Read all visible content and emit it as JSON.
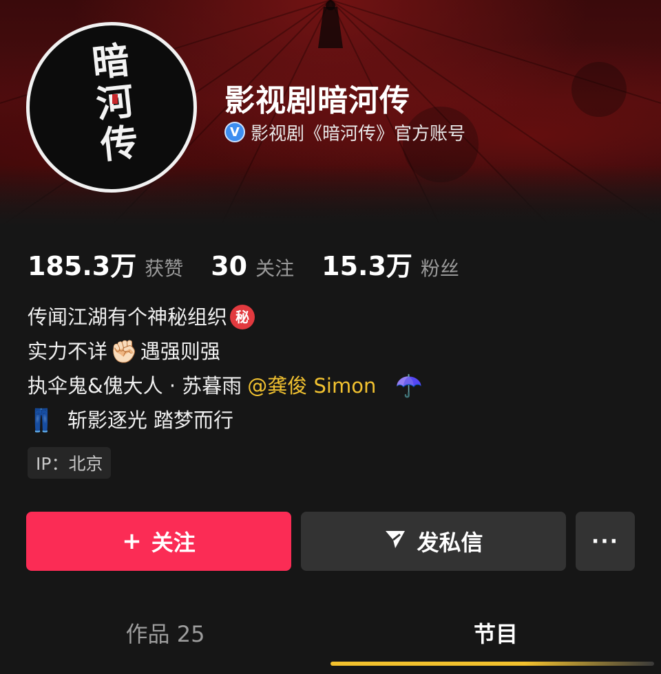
{
  "profile": {
    "avatar_text": "暗河传",
    "name": "影视剧暗河传",
    "verified_icon": "verified-badge-icon",
    "verified_icon_glyph": "V",
    "verified_text": "影视剧《暗河传》官方账号"
  },
  "stats": [
    {
      "value": "185.3万",
      "label": "获赞"
    },
    {
      "value": "30",
      "label": "关注"
    },
    {
      "value": "15.3万",
      "label": "粉丝"
    }
  ],
  "bio": {
    "line1": "传闻江湖有个神秘组织",
    "line1_icon": "秘",
    "line2_part1": "实力不详",
    "line2_icon": "✊🏻",
    "line2_part2": "遇强则强",
    "line3": "执伞鬼&傀大人 · 苏暮雨",
    "line3_mention": "@龚俊 Simon",
    "line3_icon": "☂️",
    "line4_icon": "👖",
    "line4": "斩影逐光 踏梦而行"
  },
  "ip": "IP：北京",
  "buttons": {
    "follow": "关注",
    "follow_icon": "+",
    "message": "发私信",
    "more": "···"
  },
  "tabs": {
    "works": "作品 25",
    "shows": "节目"
  },
  "colors": {
    "follow_button": "#fb2c55",
    "mention": "#f2c230",
    "tab_indicator": "#f3c12d",
    "verified": "#3d8ef0"
  }
}
